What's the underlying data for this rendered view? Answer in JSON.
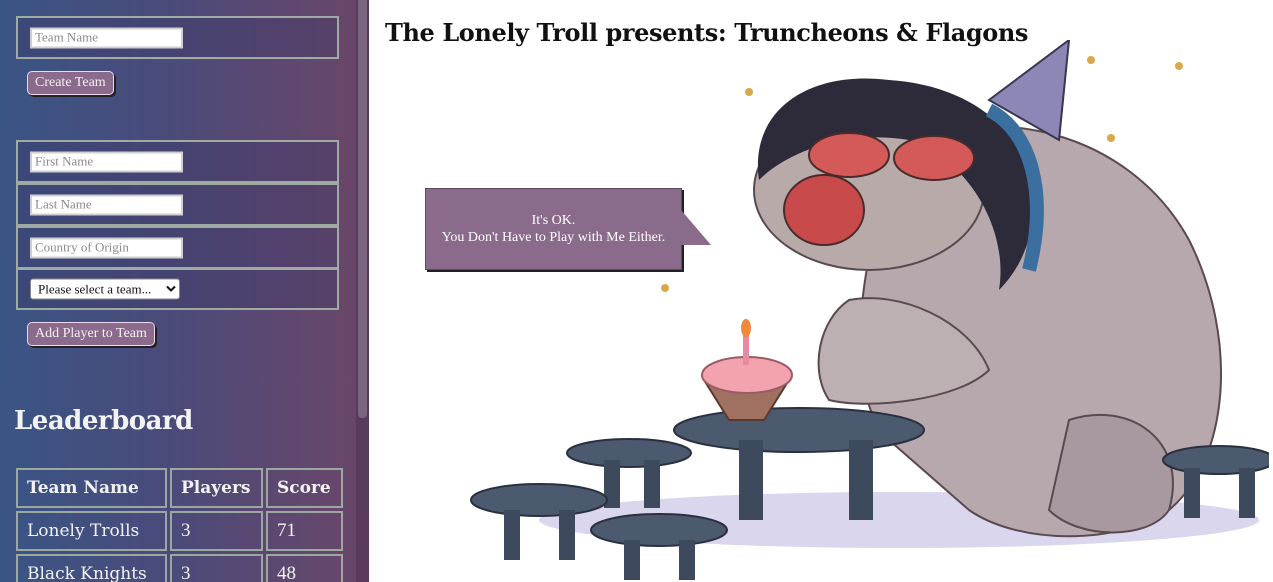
{
  "team_form": {
    "team_name_placeholder": "Team Name",
    "create_team_label": "Create Team"
  },
  "player_form": {
    "first_name_placeholder": "First Name",
    "last_name_placeholder": "Last Name",
    "country_placeholder": "Country of Origin",
    "team_select_value": "Please select a team...",
    "add_player_label": "Add Player to Team"
  },
  "leaderboard": {
    "title": "Leaderboard",
    "headers": [
      "Team Name",
      "Players",
      "Score"
    ],
    "rows": [
      {
        "team": "Lonely Trolls",
        "players": "3",
        "score": "71"
      },
      {
        "team": "Black Knights",
        "players": "3",
        "score": "48"
      }
    ]
  },
  "main": {
    "title": "The Lonely Troll presents: Truncheons & Flagons",
    "speech_line1": "It's OK.",
    "speech_line2": "You Don't Have to Play with Me Either."
  },
  "colors": {
    "button_bg": "#8b6b8b",
    "sidebar_gradient_start": "#3a5585",
    "sidebar_gradient_end": "#6b4668"
  }
}
